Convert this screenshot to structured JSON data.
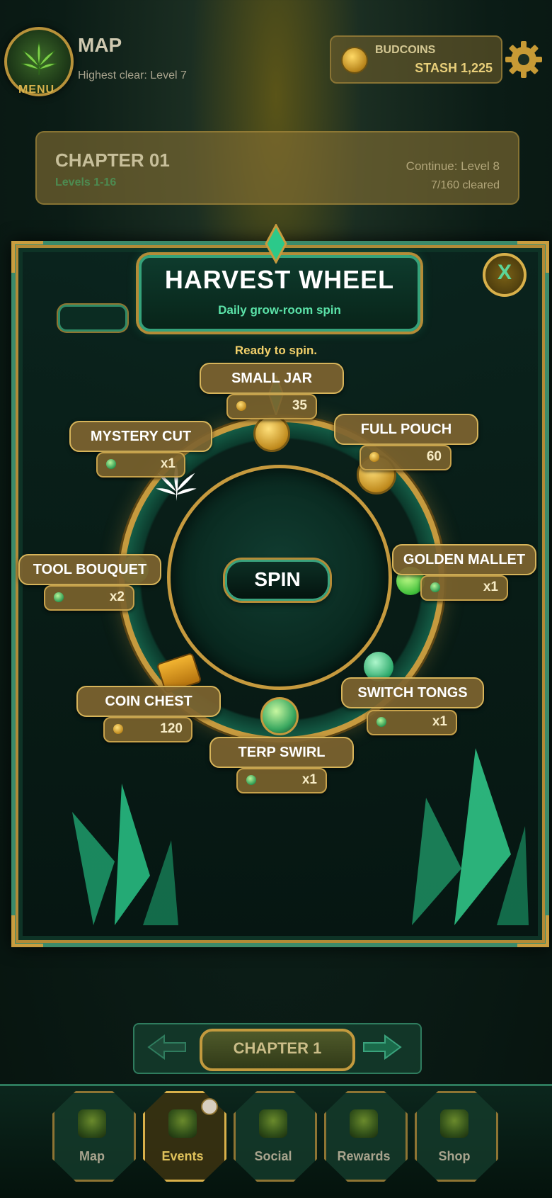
{
  "header": {
    "menu_label": "MENU",
    "map_title": "MAP",
    "highest_clear": "Highest clear: Level 7",
    "currency_label": "BUDCOINS",
    "stash": "STASH 1,225"
  },
  "chapter_card": {
    "title": "CHAPTER 01",
    "levels": "Levels 1-16",
    "continue": "Continue: Level 8",
    "cleared": "7/160 cleared"
  },
  "wheel_modal": {
    "title": "HARVEST WHEEL",
    "subtitle": "Daily grow-room spin",
    "status": "Ready to spin.",
    "spin_label": "SPIN",
    "close_label": "X",
    "rewards": [
      {
        "name": "SMALL JAR",
        "qty": "35",
        "icon": "coin-icon"
      },
      {
        "name": "FULL POUCH",
        "qty": "60",
        "icon": "coin-icon"
      },
      {
        "name": "GOLDEN MALLET",
        "qty": "x1",
        "icon": "mallet-icon"
      },
      {
        "name": "SWITCH TONGS",
        "qty": "x1",
        "icon": "tongs-icon"
      },
      {
        "name": "TERP SWIRL",
        "qty": "x1",
        "icon": "swirl-icon"
      },
      {
        "name": "COIN CHEST",
        "qty": "120",
        "icon": "coin-icon"
      },
      {
        "name": "TOOL BOUQUET",
        "qty": "x2",
        "icon": "bouquet-icon"
      },
      {
        "name": "MYSTERY CUT",
        "qty": "x1",
        "icon": "leaf-icon"
      }
    ]
  },
  "chapter_nav": {
    "label": "CHAPTER 1"
  },
  "nav": {
    "tabs": [
      {
        "label": "Map",
        "active": false
      },
      {
        "label": "Events",
        "active": true
      },
      {
        "label": "Social",
        "active": false
      },
      {
        "label": "Rewards",
        "active": false
      },
      {
        "label": "Shop",
        "active": false
      }
    ]
  },
  "colors": {
    "gold": "#c69a3e",
    "emerald": "#3aa37d",
    "accent_green": "#5be2a8",
    "status_yellow": "#f2d06a"
  }
}
